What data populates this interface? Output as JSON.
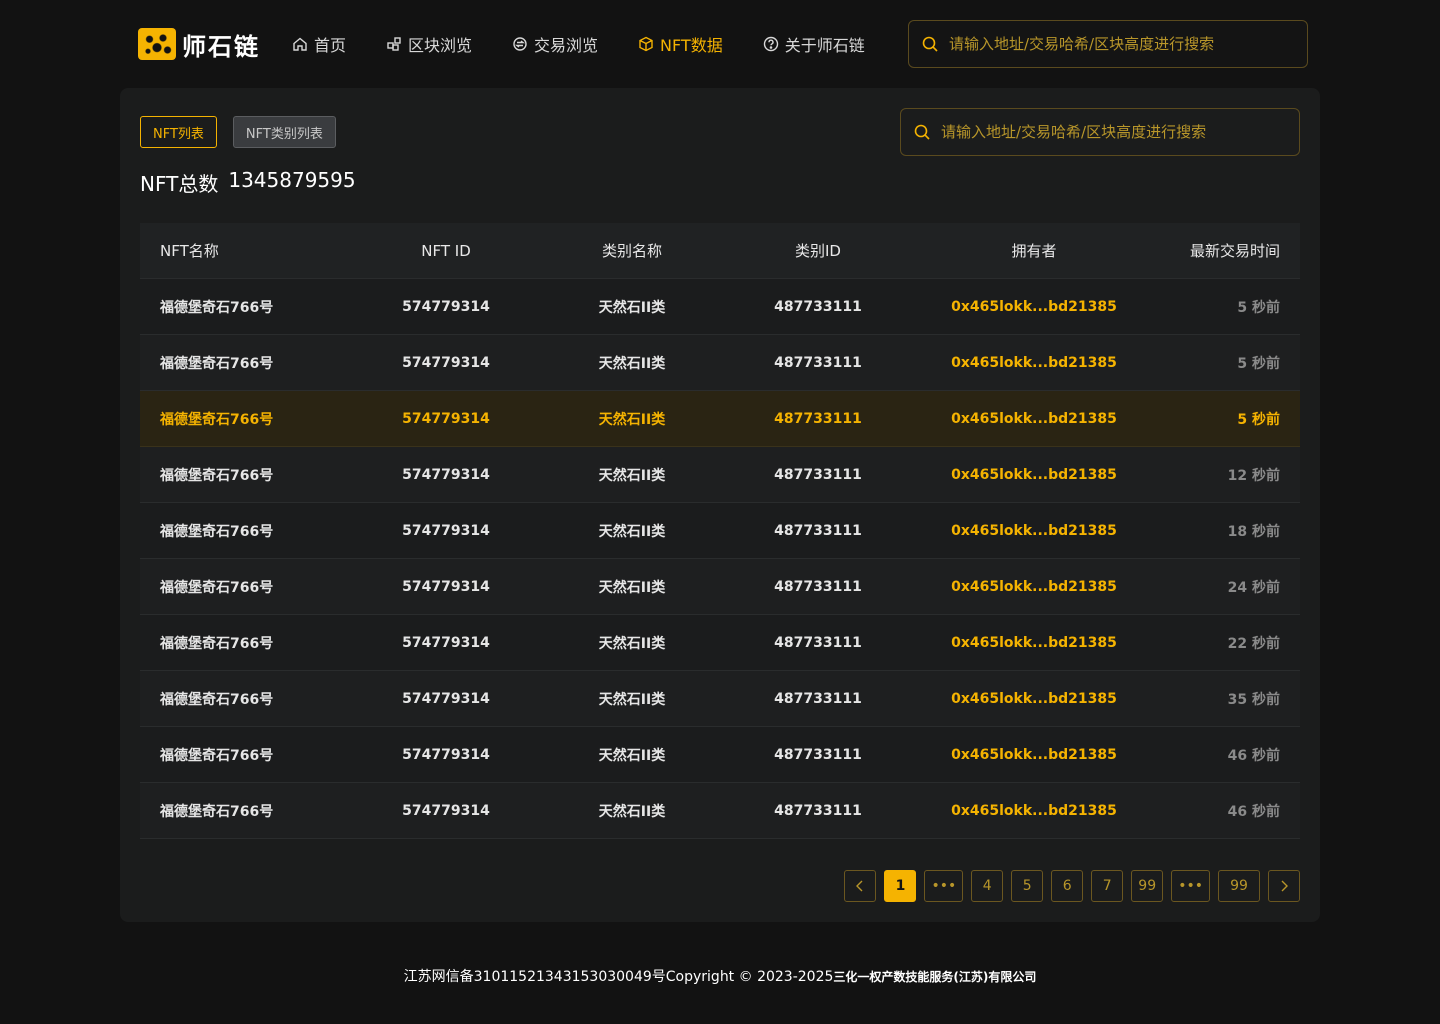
{
  "header": {
    "logo_text": "师石链",
    "nav": [
      {
        "label": "首页",
        "icon": "home-icon"
      },
      {
        "label": "区块浏览",
        "icon": "blocks-icon"
      },
      {
        "label": "交易浏览",
        "icon": "transaction-icon"
      },
      {
        "label": "NFT数据",
        "icon": "cube-icon",
        "active": true
      },
      {
        "label": "关于师石链",
        "icon": "help-circle-icon"
      }
    ],
    "search_placeholder": "请输入地址/交易哈希/区块高度进行搜索"
  },
  "panel": {
    "tabs": [
      {
        "label": "NFT列表",
        "active": true
      },
      {
        "label": "NFT类别列表",
        "active": false
      }
    ],
    "search_placeholder": "请输入地址/交易哈希/区块高度进行搜索",
    "total_label": "NFT总数",
    "total_value": "1345879595"
  },
  "table": {
    "columns": [
      "NFT名称",
      "NFT ID",
      "类别名称",
      "类别ID",
      "拥有者",
      "最新交易时间"
    ],
    "rows": [
      {
        "name": "福德堡奇石766号",
        "id": "574779314",
        "category": "天然石II类",
        "category_id": "487733111",
        "owner": "0x465lokk...bd21385",
        "time": "5 秒前"
      },
      {
        "name": "福德堡奇石766号",
        "id": "574779314",
        "category": "天然石II类",
        "category_id": "487733111",
        "owner": "0x465lokk...bd21385",
        "time": "5 秒前"
      },
      {
        "name": "福德堡奇石766号",
        "id": "574779314",
        "category": "天然石II类",
        "category_id": "487733111",
        "owner": "0x465lokk...bd21385",
        "time": "5 秒前",
        "highlighted": true
      },
      {
        "name": "福德堡奇石766号",
        "id": "574779314",
        "category": "天然石II类",
        "category_id": "487733111",
        "owner": "0x465lokk...bd21385",
        "time": "12 秒前"
      },
      {
        "name": "福德堡奇石766号",
        "id": "574779314",
        "category": "天然石II类",
        "category_id": "487733111",
        "owner": "0x465lokk...bd21385",
        "time": "18 秒前"
      },
      {
        "name": "福德堡奇石766号",
        "id": "574779314",
        "category": "天然石II类",
        "category_id": "487733111",
        "owner": "0x465lokk...bd21385",
        "time": "24 秒前"
      },
      {
        "name": "福德堡奇石766号",
        "id": "574779314",
        "category": "天然石II类",
        "category_id": "487733111",
        "owner": "0x465lokk...bd21385",
        "time": "22 秒前"
      },
      {
        "name": "福德堡奇石766号",
        "id": "574779314",
        "category": "天然石II类",
        "category_id": "487733111",
        "owner": "0x465lokk...bd21385",
        "time": "35 秒前"
      },
      {
        "name": "福德堡奇石766号",
        "id": "574779314",
        "category": "天然石II类",
        "category_id": "487733111",
        "owner": "0x465lokk...bd21385",
        "time": "46 秒前"
      },
      {
        "name": "福德堡奇石766号",
        "id": "574779314",
        "category": "天然石II类",
        "category_id": "487733111",
        "owner": "0x465lokk...bd21385",
        "time": "46 秒前"
      }
    ]
  },
  "pagination": {
    "prev_icon": "chevron-left-icon",
    "next_icon": "chevron-right-icon",
    "pages": [
      "1",
      "•••",
      "4",
      "5",
      "6",
      "7",
      "99",
      "•••",
      "99"
    ],
    "current": "1"
  },
  "footer": {
    "text": "江苏网信备31011521343153030049号Copyright © 2023-2025",
    "company": "三化一权产数技能服务(江苏)有限公司"
  },
  "colors": {
    "accent": "#F5B301",
    "background": "#121212",
    "panel": "#1b1c1c"
  }
}
